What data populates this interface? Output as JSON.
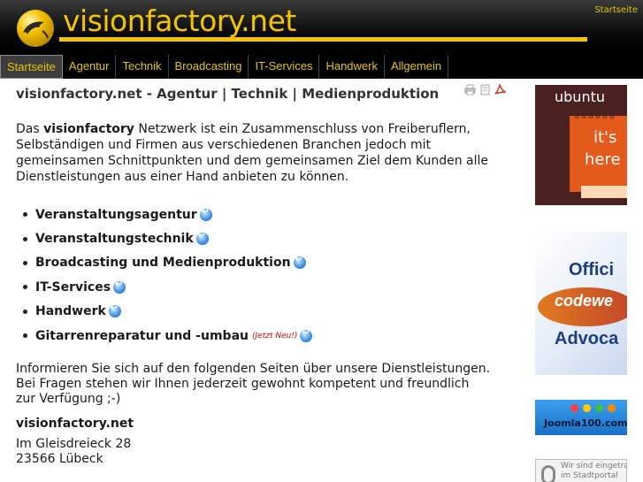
{
  "header": {
    "site_title": "visionfactory.net",
    "top_link": "Startseite"
  },
  "nav": {
    "items": [
      "Startseite",
      "Agentur",
      "Technik",
      "Broadcasting",
      "IT-Services",
      "Handwerk",
      "Allgemein"
    ],
    "active": "Startseite"
  },
  "main": {
    "title": "visionfactory.net - Agentur | Technik | Medienproduktion",
    "intro_pre": "Das ",
    "intro_bold": "visionfactory",
    "intro_post": " Netzwerk ist ein Zusammenschluss von Freiberuflern, Selbständigen und Firmen aus verschiedenen Branchen jedoch mit gemeinsamen Schnittpunkten und dem gemeinsamen Ziel dem Kunden alle Dienstleistungen aus einer Hand anbieten zu können.",
    "services": [
      "Veranstaltungsagentur",
      "Veranstaltungstechnik",
      "Broadcasting und Medienproduktion",
      "IT-Services",
      "Handwerk",
      "Gitarrenreparatur und -umbau"
    ],
    "new_badge": "(Jetzt Neu!)",
    "info_line1": "Informieren Sie sich auf den folgenden Seiten über unsere Dienstleistungen.",
    "info_line2": "Bei Fragen stehen wir Ihnen jederzeit gewohnt kompetent und freundlich",
    "info_line3": "zur Verfügung ;-)",
    "company": "visionfactory.net",
    "street": "Im Gleisdreieck 28",
    "city": "23566 Lübeck"
  },
  "sidebar": {
    "ubuntu_brand": "ubuntu",
    "ubuntu_line1": "it's",
    "ubuntu_line2": "here",
    "office_line1": "Offici",
    "office_line2": "codewe",
    "office_line3": "Advoca",
    "joomla_text": "Joomla100.com",
    "stadt_text": "Wir sind eingetra im Stadtportal"
  },
  "colors": {
    "accent": "#f2c500",
    "nav_bg": "#000000",
    "new_badge": "#cc1100"
  }
}
